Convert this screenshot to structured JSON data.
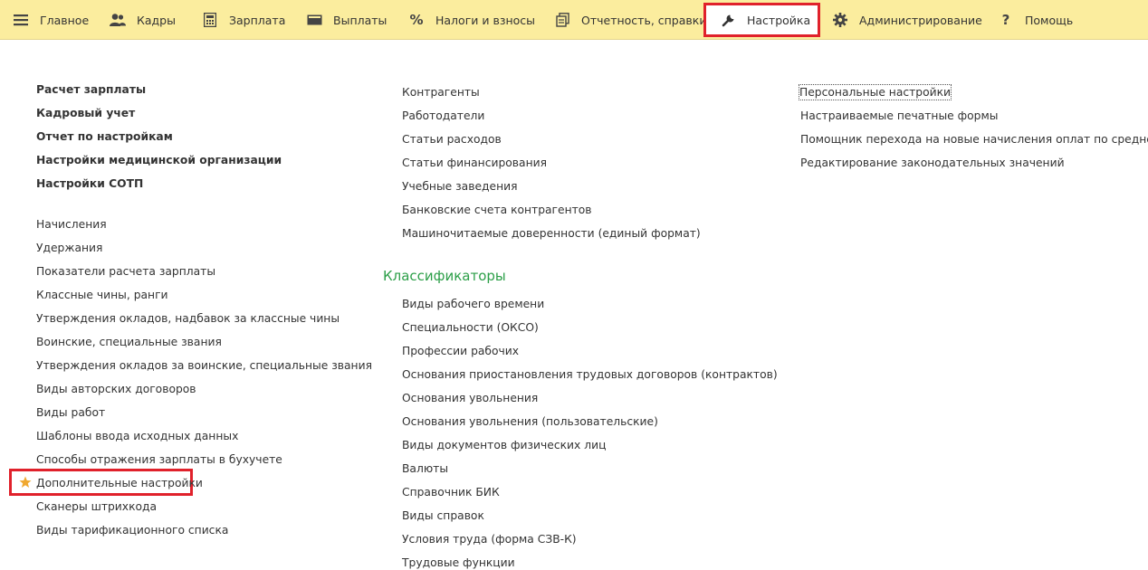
{
  "menu": {
    "items": [
      {
        "id": "main",
        "label": "Главное",
        "icon": "hamburger-menu-icon"
      },
      {
        "id": "hr",
        "label": "Кадры",
        "icon": "people-icon"
      },
      {
        "id": "salary",
        "label": "Зарплата",
        "icon": "calculator-icon"
      },
      {
        "id": "payments",
        "label": "Выплаты",
        "icon": "wallet-icon"
      },
      {
        "id": "taxes",
        "label": "Налоги и взносы",
        "icon": "percent-icon"
      },
      {
        "id": "reports",
        "label": "Отчетность, справки",
        "icon": "documents-icon"
      },
      {
        "id": "settings",
        "label": "Настройка",
        "icon": "wrench-icon",
        "active": true
      },
      {
        "id": "admin",
        "label": "Администрирование",
        "icon": "gear-icon"
      },
      {
        "id": "help",
        "label": "Помощь",
        "icon": "question-icon"
      }
    ]
  },
  "col1": {
    "bold_links": [
      "Расчет зарплаты",
      "Кадровый учет",
      "Отчет по настройкам",
      "Настройки медицинской организации",
      "Настройки СОТП"
    ],
    "links": [
      "Начисления",
      "Удержания",
      "Показатели расчета зарплаты",
      "Классные чины, ранги",
      "Утверждения окладов, надбавок за классные чины",
      "Воинские, специальные звания",
      "Утверждения окладов за воинские, специальные звания",
      "Виды авторских договоров",
      "Виды работ",
      "Шаблоны ввода исходных данных",
      "Способы отражения зарплаты в бухучете",
      "Дополнительные настройки",
      "Сканеры штрихкода",
      "Виды тарификационного списка"
    ]
  },
  "col2": {
    "links": [
      "Контрагенты",
      "Работодатели",
      "Статьи расходов",
      "Статьи финансирования",
      "Учебные заведения",
      "Банковские счета контрагентов",
      "Машиночитаемые доверенности (единый формат)"
    ],
    "classifiers_title": "Классификаторы",
    "classifiers": [
      "Виды рабочего времени",
      "Специальности (ОКСО)",
      "Профессии рабочих",
      "Основания приостановления трудовых договоров (контрактов)",
      "Основания увольнения",
      "Основания увольнения (пользовательские)",
      "Виды документов физических лиц",
      "Валюты",
      "Справочник БИК",
      "Виды справок",
      "Условия труда (форма СЗВ-К)",
      "Трудовые функции"
    ]
  },
  "col3": {
    "links": [
      "Персональные настройки",
      "Настраиваемые печатные формы",
      "Помощник перехода на новые начисления оплат по среднему",
      "Редактирование законодательных значений"
    ]
  },
  "colors": {
    "menubar_bg": "#fbed9e",
    "highlight_red": "#e0212b",
    "section_green": "#2c9f48",
    "star": "#f0a830"
  }
}
